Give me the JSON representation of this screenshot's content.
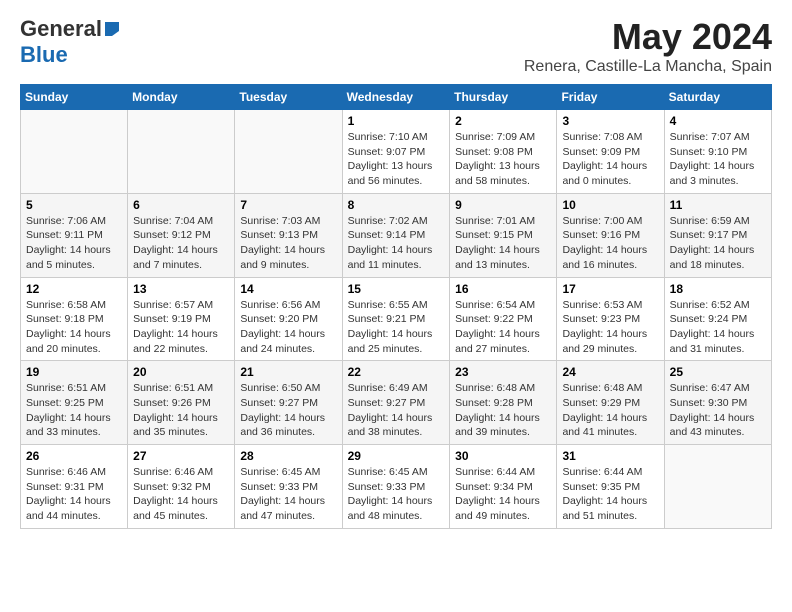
{
  "header": {
    "logo_general": "General",
    "logo_blue": "Blue",
    "title": "May 2024",
    "subtitle": "Renera, Castille-La Mancha, Spain"
  },
  "days_of_week": [
    "Sunday",
    "Monday",
    "Tuesday",
    "Wednesday",
    "Thursday",
    "Friday",
    "Saturday"
  ],
  "weeks": [
    [
      {
        "num": "",
        "info": ""
      },
      {
        "num": "",
        "info": ""
      },
      {
        "num": "",
        "info": ""
      },
      {
        "num": "1",
        "info": "Sunrise: 7:10 AM\nSunset: 9:07 PM\nDaylight: 13 hours and 56 minutes."
      },
      {
        "num": "2",
        "info": "Sunrise: 7:09 AM\nSunset: 9:08 PM\nDaylight: 13 hours and 58 minutes."
      },
      {
        "num": "3",
        "info": "Sunrise: 7:08 AM\nSunset: 9:09 PM\nDaylight: 14 hours and 0 minutes."
      },
      {
        "num": "4",
        "info": "Sunrise: 7:07 AM\nSunset: 9:10 PM\nDaylight: 14 hours and 3 minutes."
      }
    ],
    [
      {
        "num": "5",
        "info": "Sunrise: 7:06 AM\nSunset: 9:11 PM\nDaylight: 14 hours and 5 minutes."
      },
      {
        "num": "6",
        "info": "Sunrise: 7:04 AM\nSunset: 9:12 PM\nDaylight: 14 hours and 7 minutes."
      },
      {
        "num": "7",
        "info": "Sunrise: 7:03 AM\nSunset: 9:13 PM\nDaylight: 14 hours and 9 minutes."
      },
      {
        "num": "8",
        "info": "Sunrise: 7:02 AM\nSunset: 9:14 PM\nDaylight: 14 hours and 11 minutes."
      },
      {
        "num": "9",
        "info": "Sunrise: 7:01 AM\nSunset: 9:15 PM\nDaylight: 14 hours and 13 minutes."
      },
      {
        "num": "10",
        "info": "Sunrise: 7:00 AM\nSunset: 9:16 PM\nDaylight: 14 hours and 16 minutes."
      },
      {
        "num": "11",
        "info": "Sunrise: 6:59 AM\nSunset: 9:17 PM\nDaylight: 14 hours and 18 minutes."
      }
    ],
    [
      {
        "num": "12",
        "info": "Sunrise: 6:58 AM\nSunset: 9:18 PM\nDaylight: 14 hours and 20 minutes."
      },
      {
        "num": "13",
        "info": "Sunrise: 6:57 AM\nSunset: 9:19 PM\nDaylight: 14 hours and 22 minutes."
      },
      {
        "num": "14",
        "info": "Sunrise: 6:56 AM\nSunset: 9:20 PM\nDaylight: 14 hours and 24 minutes."
      },
      {
        "num": "15",
        "info": "Sunrise: 6:55 AM\nSunset: 9:21 PM\nDaylight: 14 hours and 25 minutes."
      },
      {
        "num": "16",
        "info": "Sunrise: 6:54 AM\nSunset: 9:22 PM\nDaylight: 14 hours and 27 minutes."
      },
      {
        "num": "17",
        "info": "Sunrise: 6:53 AM\nSunset: 9:23 PM\nDaylight: 14 hours and 29 minutes."
      },
      {
        "num": "18",
        "info": "Sunrise: 6:52 AM\nSunset: 9:24 PM\nDaylight: 14 hours and 31 minutes."
      }
    ],
    [
      {
        "num": "19",
        "info": "Sunrise: 6:51 AM\nSunset: 9:25 PM\nDaylight: 14 hours and 33 minutes."
      },
      {
        "num": "20",
        "info": "Sunrise: 6:51 AM\nSunset: 9:26 PM\nDaylight: 14 hours and 35 minutes."
      },
      {
        "num": "21",
        "info": "Sunrise: 6:50 AM\nSunset: 9:27 PM\nDaylight: 14 hours and 36 minutes."
      },
      {
        "num": "22",
        "info": "Sunrise: 6:49 AM\nSunset: 9:27 PM\nDaylight: 14 hours and 38 minutes."
      },
      {
        "num": "23",
        "info": "Sunrise: 6:48 AM\nSunset: 9:28 PM\nDaylight: 14 hours and 39 minutes."
      },
      {
        "num": "24",
        "info": "Sunrise: 6:48 AM\nSunset: 9:29 PM\nDaylight: 14 hours and 41 minutes."
      },
      {
        "num": "25",
        "info": "Sunrise: 6:47 AM\nSunset: 9:30 PM\nDaylight: 14 hours and 43 minutes."
      }
    ],
    [
      {
        "num": "26",
        "info": "Sunrise: 6:46 AM\nSunset: 9:31 PM\nDaylight: 14 hours and 44 minutes."
      },
      {
        "num": "27",
        "info": "Sunrise: 6:46 AM\nSunset: 9:32 PM\nDaylight: 14 hours and 45 minutes."
      },
      {
        "num": "28",
        "info": "Sunrise: 6:45 AM\nSunset: 9:33 PM\nDaylight: 14 hours and 47 minutes."
      },
      {
        "num": "29",
        "info": "Sunrise: 6:45 AM\nSunset: 9:33 PM\nDaylight: 14 hours and 48 minutes."
      },
      {
        "num": "30",
        "info": "Sunrise: 6:44 AM\nSunset: 9:34 PM\nDaylight: 14 hours and 49 minutes."
      },
      {
        "num": "31",
        "info": "Sunrise: 6:44 AM\nSunset: 9:35 PM\nDaylight: 14 hours and 51 minutes."
      },
      {
        "num": "",
        "info": ""
      }
    ]
  ]
}
